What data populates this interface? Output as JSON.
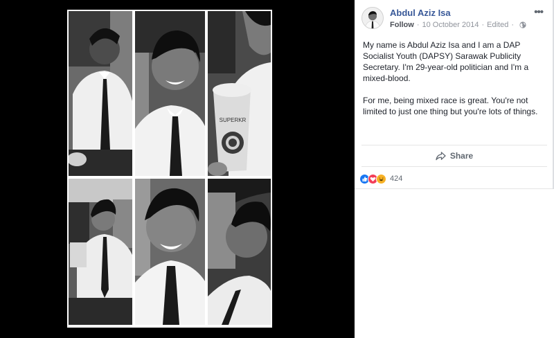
{
  "post": {
    "author": "Abdul Aziz Isa",
    "follow_label": "Follow",
    "date": "10 October 2014",
    "edited_label": "Edited",
    "separator": "·",
    "more_label": "•••",
    "paragraphs": [
      "My name is Abdul Aziz Isa and I am a DAP Socialist Youth (DAPSY) Sarawak Publicity Secretary. I'm 29-year-old politician and I'm a mixed-blood.",
      "For me, being mixed race is great. You're not limited to just one thing but you're lots of things."
    ]
  },
  "actions": {
    "share_label": "Share"
  },
  "reactions": {
    "count": "424",
    "types": [
      "like-icon",
      "love-icon",
      "haha-icon"
    ],
    "colors": {
      "like": "#1877f2",
      "love": "#f33e58",
      "haha": "#f7b125"
    }
  },
  "photo": {
    "cup_text": "SUPERKR"
  },
  "colors": {
    "author": "#385898",
    "meta": "#90949c",
    "text": "#1d2129"
  }
}
